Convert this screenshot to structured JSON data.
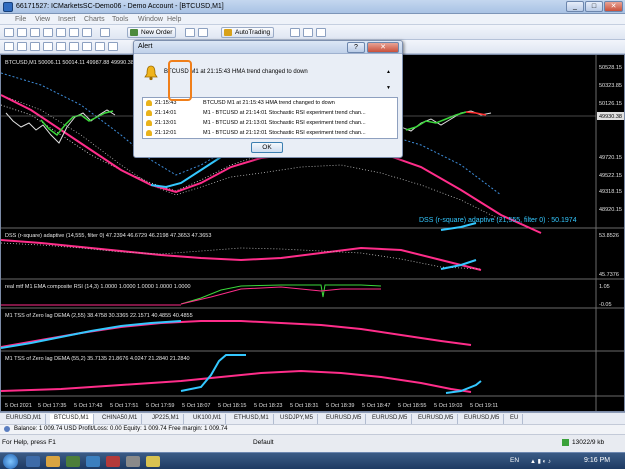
{
  "window": {
    "title": "66171527: ICMarketsSC-Demo06 - Demo Account - [BTCUSD,M1]"
  },
  "menu": [
    "File",
    "View",
    "Insert",
    "Charts",
    "Tools",
    "Window",
    "Help"
  ],
  "toolbar": {
    "new_order": "New Order",
    "autotrading": "AutoTrading"
  },
  "chart": {
    "main_label": "BTCUSD,M1 50006.11 50014.11 49987.88 49990.38",
    "price_labels": [
      "50528.15",
      "50323.85",
      "50126.15",
      "49930.38",
      "49720.15",
      "49522.15",
      "49318.15",
      "48920.15"
    ],
    "dss_label": "DSS (r-square) adaptive (21,555, filter 0) : 50.1974",
    "sub1_label": "DSS (r-square) adaptive (14,555, filter 0) 47.2394 46.6729 46.2198 47.3653 47.3653",
    "sub1_scale": [
      "53.8526",
      "45.7376"
    ],
    "sub2_label": "real mtf M1 EMA composite RSI (14,3) 1.0000 1.0000 1.0000 1.0000 1.0000",
    "sub2_scale": [
      "1.05",
      "-0.05"
    ],
    "sub3_label": "M1 TSS of Zero lag DEMA (2,55) 38.4758 30.3365 22.1571 40.4855 40.4855",
    "sub4_label": "M1 TSS of Zero lag DEMA (55,2) 35.7135 21.8676 4.0247 21.2840 21.2840",
    "time_labels": [
      "5 Oct 2021",
      "5 Oct 17:35",
      "5 Oct 17:43",
      "5 Oct 17:51",
      "5 Oct 17:59",
      "5 Oct 18:07",
      "5 Oct 18:15",
      "5 Oct 18:23",
      "5 Oct 18:31",
      "5 Oct 18:39",
      "5 Oct 18:47",
      "5 Oct 18:55",
      "5 Oct 19:03",
      "5 Oct 19:11"
    ]
  },
  "alert": {
    "title": "Alert",
    "main_message": "BTCUSD M1 at 21:15:43 HMA trend changed to down",
    "rows": [
      {
        "time": "21:15:43",
        "message": "BTCUSD M1 at 21:15:43 HMA trend changed to down"
      },
      {
        "time": "21:14:01",
        "message": "M1 - BTCUSD at 21:14:01 Stochastic RSI experiment trend chan..."
      },
      {
        "time": "21:13:01",
        "message": "M1 - BTCUSD at 21:13:01 Stochastic RSI experiment trend chan..."
      },
      {
        "time": "21:12:01",
        "message": "M1 - BTCUSD at 21:12:01 Stochastic RSI experiment trend chan..."
      }
    ],
    "ok_label": "OK"
  },
  "tabs": [
    "EURUSD,M1",
    "BTCUSD,M1",
    "CHINA50,M1",
    "JP225,M1",
    "UK100,M1",
    "ETHUSD,M1",
    "USDJPY,M5",
    "EURUSD,M5",
    "EURUSD,M5",
    "EURUSD,M5",
    "EURUSD,M5",
    "EU"
  ],
  "status": {
    "balance_line": "Balance: 1 009.74 USD  Profit/Loss: 0.00  Equity: 1 009.74  Free margin: 1 009.74",
    "help": "For Help, press F1",
    "profile": "Default",
    "traffic": "13022/9 kb"
  },
  "taskbar": {
    "lang": "EN",
    "time": "9:16 PM"
  }
}
